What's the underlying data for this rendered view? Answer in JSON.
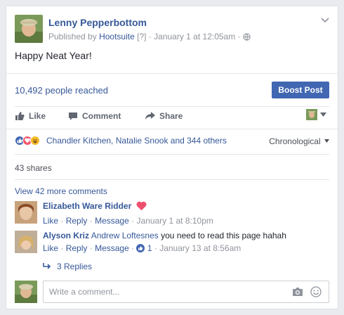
{
  "post": {
    "author": "Lenny Pepperbottom",
    "published_by_prefix": "Published by",
    "publisher": "Hootsuite",
    "help_marker": "[?]",
    "separator": "·",
    "date": "January 1 at 12:05am",
    "privacy_icon": "globe-icon",
    "text": "Happy Neat Year!"
  },
  "insights": {
    "reach": "10,492 people reached",
    "boost_label": "Boost Post"
  },
  "actions": {
    "like": "Like",
    "comment": "Comment",
    "share": "Share"
  },
  "reactions": {
    "icons": [
      "like-icon",
      "love-icon",
      "haha-icon"
    ],
    "summary": "Chandler Kitchen, Natalie Snook and 344 others",
    "sort_label": "Chronological",
    "colors": {
      "like": "#4267b2",
      "love": "#f25268",
      "haha": "#f7b928"
    }
  },
  "shares_count": "43 shares",
  "view_more_comments": "View 42 more comments",
  "comments": [
    {
      "author": "Elizabeth Ware Ridder",
      "text": "",
      "emoji": "heart",
      "like": "Like",
      "reply": "Reply",
      "message": "Message",
      "timestamp": "January 1 at 8:10pm"
    },
    {
      "author": "Alyson Kriz",
      "mention": "Andrew Loftesnes",
      "text": "you need to read this page hahah",
      "like": "Like",
      "reply": "Reply",
      "message": "Message",
      "like_count": "1",
      "timestamp": "January 13 at 8:56am"
    }
  ],
  "replies_link": "3 Replies",
  "composer": {
    "placeholder": "Write a comment..."
  },
  "theme": {
    "brand": "#4267b2",
    "link": "#365899",
    "muted": "#90949c"
  }
}
